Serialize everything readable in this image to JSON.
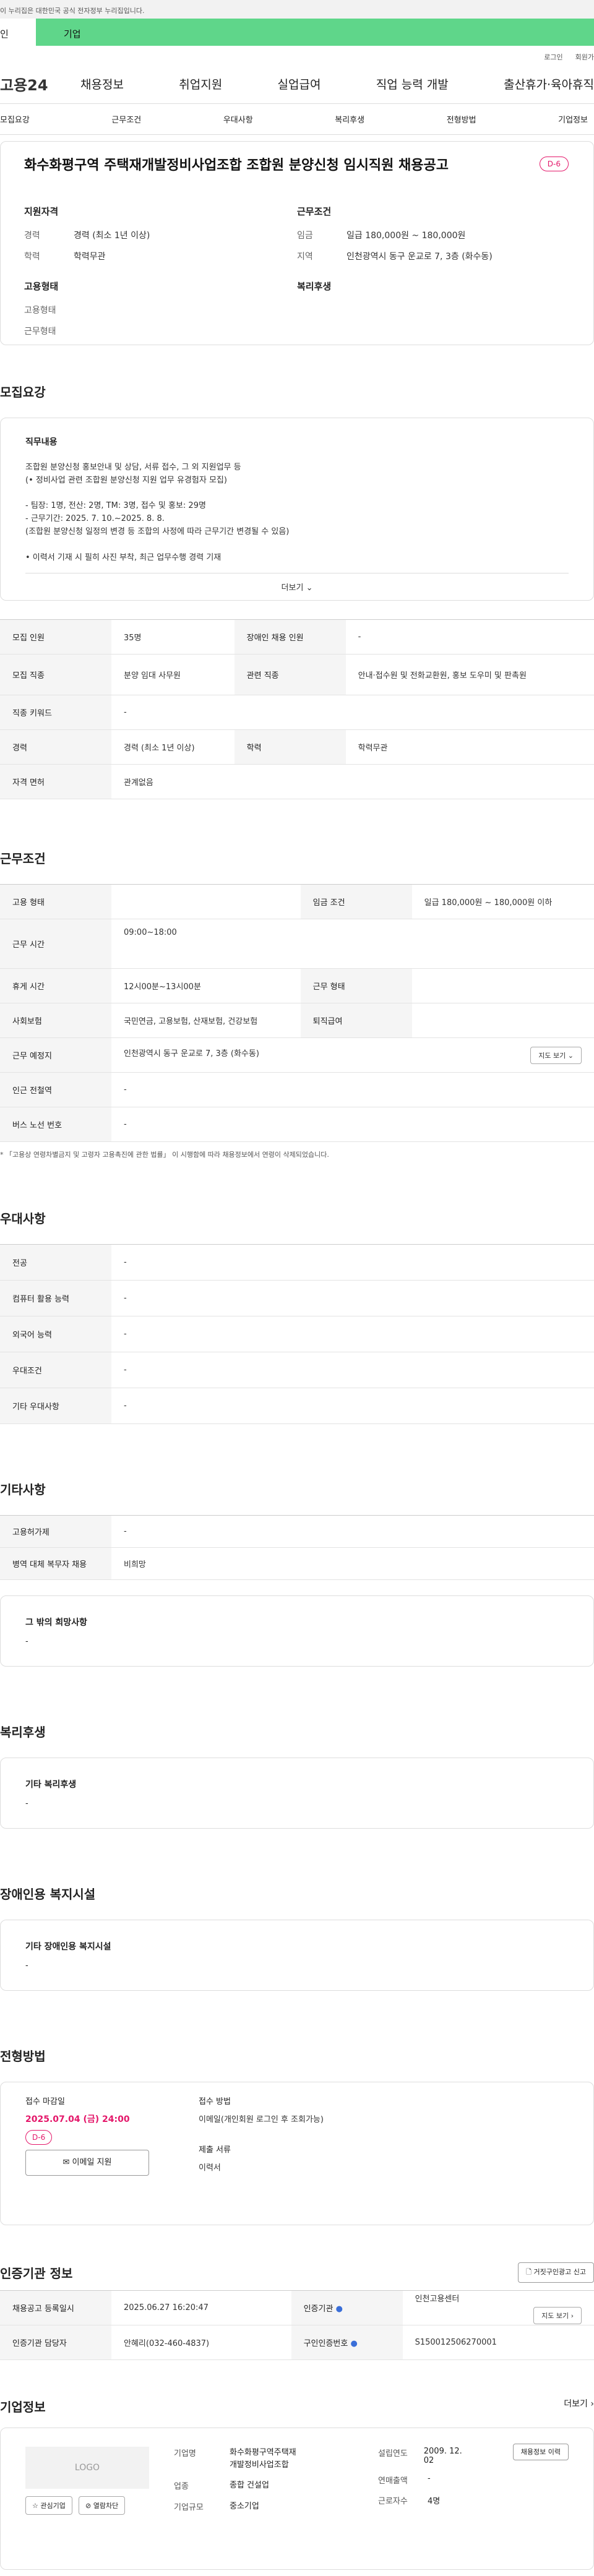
{
  "gov_banner": "이 누리집은 대한민국 공식 전자정부 누리집입니다.",
  "tabs": {
    "person": "인",
    "business": "기업"
  },
  "util": {
    "login": "로그인",
    "signup": "회원가"
  },
  "logo": "고용24",
  "gnb": [
    "채용정보",
    "취업지원",
    "실업급여",
    "직업 능력 개발",
    "출산휴가·육아휴직"
  ],
  "anchor_nav": [
    "모집요강",
    "근무조건",
    "우대사항",
    "복리후생",
    "전형방법",
    "기업정보"
  ],
  "summary": {
    "title": "화수화평구역 주택재개발정비사업조합 조합원 분양신청 임시직원 채용공고",
    "dday": "D-6",
    "qual_title": "지원자격",
    "career_k": "경력",
    "career_v": "경력 (최소 1년 이상)",
    "edu_k": "학력",
    "edu_v": "학력무관",
    "work_title": "근무조건",
    "wage_k": "임금",
    "wage_v": "일급 180,000원 ~ 180,000원",
    "region_k": "지역",
    "region_v": "인천광역시 동구 운교로 7, 3층 (화수동)",
    "emp_title": "고용형태",
    "emp_k1": "고용형태",
    "emp_k2": "근무형태",
    "welfare_title": "복리후생"
  },
  "recruit": {
    "section": "모집요강",
    "box_title": "직무내용",
    "body": "조합원 분양신청 홍보안내 및 상담, 서류 접수, 그 외 지원업무 등\n(• 정비사업 관련 조합원 분양신청 지원 업무 유경험자 모집)\n\n- 팀장: 1명, 전산: 2명, TM: 3명, 접수 및 홍보: 29명\n- 근무기간: 2025. 7. 10.~2025. 8. 8.\n  (조합원 분양신청 일정의 변경 등 조합의 사정에 따라 근무기간 변경될 수 있음)\n\n• 이력서 기재 시 필히 사진 부착, 최근 업무수행 경력 기재",
    "more": "더보기"
  },
  "recruit_table": [
    {
      "k1": "모집 인원",
      "v1": "35명",
      "k2": "장애인 채용 인원",
      "v2": "-"
    },
    {
      "k1": "모집 직종",
      "v1": "분양 임대 사무원",
      "k2": "관련 직종",
      "v2": "안내·접수원 및 전화교환원, 홍보 도우미 및 판촉원"
    },
    {
      "k1": "직종 키워드",
      "v1": "-"
    },
    {
      "k1": "경력",
      "v1": "경력 (최소 1년 이상)",
      "k2": "학력",
      "v2": "학력무관"
    },
    {
      "k1": "자격 면허",
      "v1": "관계없음"
    }
  ],
  "conditions": {
    "section": "근무조건",
    "emp_type_k": "고용 형태",
    "emp_type_v": "",
    "wage_k": "임금 조건",
    "wage_v": "일급 180,000원 ~ 180,000원 이하",
    "hours_k": "근무 시간",
    "hours_v": "09:00~18:00",
    "break_k": "휴게 시간",
    "break_v": "12시00분~13시00분",
    "work_form_k": "근무 형태",
    "work_form_v": "",
    "ins_k": "사회보험",
    "ins_v": "국민연금, 고용보험, 산재보험, 건강보험",
    "retire_k": "퇴직급여",
    "retire_v": "",
    "place_k": "근무 예정지",
    "place_v": "인천광역시 동구 운교로 7, 3층 (화수동)",
    "map_btn": "지도 보기",
    "subway_k": "인근 전철역",
    "subway_v": "-",
    "bus_k": "버스 노선 번호",
    "bus_v": "-",
    "note": "* 「고용상 연령차별금지 및 고령자 고용촉진에 관한 법률」 이 시행함에 따라 채용정보에서 연령이 삭제되었습니다."
  },
  "preference": {
    "section": "우대사항",
    "rows": [
      {
        "k": "전공",
        "v": "-"
      },
      {
        "k": "컴퓨터 활용 능력",
        "v": "-"
      },
      {
        "k": "외국어 능력",
        "v": "-"
      },
      {
        "k": "우대조건",
        "v": "-"
      },
      {
        "k": "기타 우대사항",
        "v": "-"
      }
    ]
  },
  "etc": {
    "section": "기타사항",
    "rows": [
      {
        "k": "고용허가제",
        "v": "-"
      },
      {
        "k": "병역 대체 복무자 채용",
        "v": "비희망"
      }
    ],
    "box_title": "그 밖의 희망사항",
    "box_value": "-"
  },
  "welfare": {
    "section": "복리후생",
    "box_title": "기타 복리후생",
    "box_value": "-"
  },
  "disability": {
    "section": "장애인용 복지시설",
    "box_title": "기타 장애인용 복지시설",
    "box_value": "-"
  },
  "apply": {
    "section": "전형방법",
    "deadline_label": "접수 마감일",
    "deadline": "2025.07.04 (금) 24:00",
    "dday": "D-6",
    "email_btn": "이메일 지원",
    "method_label": "접수 방법",
    "method_value": "이메일(개인회원 로그인 후 조회가능)",
    "docs_label": "제출 서류",
    "docs_value": "이력서"
  },
  "cert": {
    "section": "인증기관 정보",
    "report_btn": "거짓구인광고 신고",
    "reg_k": "채용공고 등록일시",
    "reg_v": "2025.06.27 16:20:47",
    "org_k": "인증기관",
    "org_v": "인천고용센터",
    "map_btn": "지도 보기",
    "staff_k": "인증기관 담당자",
    "staff_v": "안혜리(032-460-4837)",
    "num_k": "구인인증번호",
    "num_v": "S150012506270001"
  },
  "company": {
    "section": "기업정보",
    "more": "더보기",
    "logo_text": "LOGO",
    "fav_btn": "관심기업",
    "block_btn": "열람차단",
    "name_k": "기업명",
    "name_v": "화수화평구역주택재개발정비사업조합",
    "industry_k": "업종",
    "industry_v": "종합 건설업",
    "scale_k": "기업규모",
    "scale_v": "중소기업",
    "founded_k": "설립연도",
    "founded_v": "2009. 12. 02",
    "sales_k": "연매출액",
    "sales_v": "-",
    "emp_k": "근로자수",
    "emp_v": "4명",
    "job_btn": "채용정보 이력"
  }
}
